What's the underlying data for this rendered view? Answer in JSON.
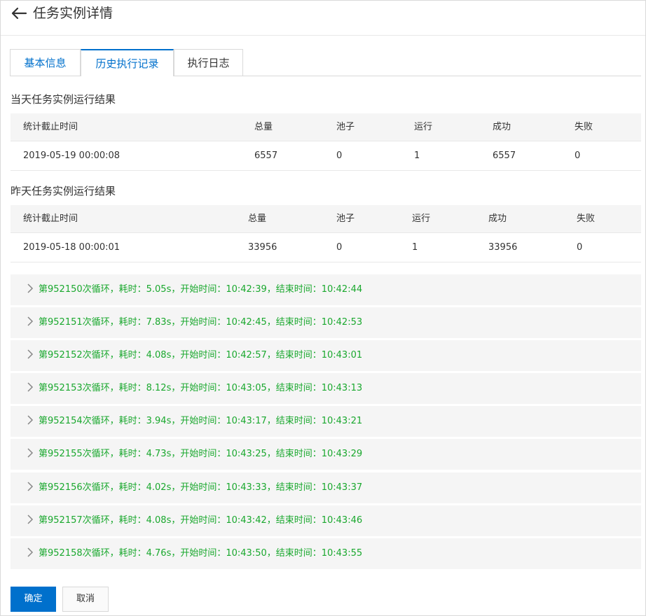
{
  "page": {
    "title": "任务实例详情"
  },
  "tabs": [
    {
      "label": "基本信息"
    },
    {
      "label": "历史执行记录"
    },
    {
      "label": "执行日志"
    }
  ],
  "today": {
    "title": "当天任务实例运行结果",
    "headers": [
      "统计截止时间",
      "总量",
      "池子",
      "运行",
      "成功",
      "失败"
    ],
    "row": [
      "2019-05-19 00:00:08",
      "6557",
      "0",
      "1",
      "6557",
      "0"
    ]
  },
  "yesterday": {
    "title": "昨天任务实例运行结果",
    "headers": [
      "统计截止时间",
      "总量",
      "池子",
      "运行",
      "成功",
      "失败"
    ],
    "row": [
      "2019-05-18 00:00:01",
      "33956",
      "0",
      "1",
      "33956",
      "0"
    ]
  },
  "loops": [
    {
      "text": "第952150次循环，耗时：5.05s，开始时间：10:42:39，结束时间：10:42:44"
    },
    {
      "text": "第952151次循环，耗时：7.83s，开始时间：10:42:45，结束时间：10:42:53"
    },
    {
      "text": "第952152次循环，耗时：4.08s，开始时间：10:42:57，结束时间：10:43:01"
    },
    {
      "text": "第952153次循环，耗时：8.12s，开始时间：10:43:05，结束时间：10:43:13"
    },
    {
      "text": "第952154次循环，耗时：3.94s，开始时间：10:43:17，结束时间：10:43:21"
    },
    {
      "text": "第952155次循环，耗时：4.73s，开始时间：10:43:25，结束时间：10:43:29"
    },
    {
      "text": "第952156次循环，耗时：4.02s，开始时间：10:43:33，结束时间：10:43:37"
    },
    {
      "text": "第952157次循环，耗时：4.08s，开始时间：10:43:42，结束时间：10:43:46"
    },
    {
      "text": "第952158次循环，耗时：4.76s，开始时间：10:43:50，结束时间：10:43:55"
    }
  ],
  "footer": {
    "ok_label": "确定",
    "cancel_label": "取消"
  },
  "colors": {
    "accent": "#0070cc",
    "success_text": "#1aa82e",
    "row_bg": "#f5f5f5"
  }
}
